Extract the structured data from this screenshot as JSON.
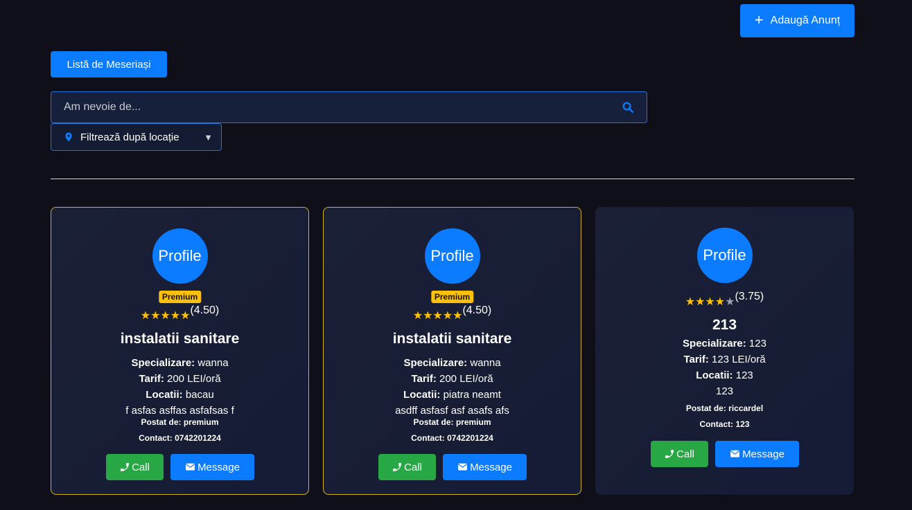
{
  "header": {
    "add_button_icon": "plus-icon",
    "add_button_label": "Adaugă Anunț",
    "list_button_label": "Listă de Meseriași"
  },
  "search": {
    "placeholder": "Am nevoie de...",
    "icon": "search-icon"
  },
  "location_filter": {
    "icon": "map-pin-icon",
    "label": "Filtrează după locație",
    "caret": "▼"
  },
  "colors": {
    "background": "#0e0f19",
    "accent": "#0b7bff",
    "premium_border": "#d4b21f",
    "star": "#ffc107",
    "call": "#28a745"
  },
  "cards": [
    {
      "premium": true,
      "avatar_text": "Profile",
      "badge": "Premium",
      "stars": 5,
      "rating": "(4.50)",
      "title": "instalatii sanitare",
      "specializare_label": "Specializare:",
      "specializare": "wanna",
      "tarif_label": "Tarif:",
      "tarif": "200 LEI/oră",
      "locatii_label": "Locatii:",
      "locatii": "bacau",
      "description": "f asfas asffas asfafsas f",
      "postat": "Postat de: premium",
      "contact": "Contact: 0742201224",
      "call_label": "Call",
      "message_label": "Message"
    },
    {
      "premium": true,
      "avatar_text": "Profile",
      "badge": "Premium",
      "stars": 5,
      "rating": "(4.50)",
      "title": "instalatii sanitare",
      "specializare_label": "Specializare:",
      "specializare": "wanna",
      "tarif_label": "Tarif:",
      "tarif": "200 LEI/oră",
      "locatii_label": "Locatii:",
      "locatii": "piatra neamt",
      "description": "asdff asfasf asf asafs afs",
      "postat": "Postat de: premium",
      "contact": "Contact: 0742201224",
      "call_label": "Call",
      "message_label": "Message"
    },
    {
      "premium": false,
      "avatar_text": "Profile",
      "stars": 4,
      "rating": "(3.75)",
      "title": "213",
      "specializare_label": "Specializare:",
      "specializare": "123",
      "tarif_label": "Tarif:",
      "tarif": "123 LEI/oră",
      "locatii_label": "Locatii:",
      "locatii": "123",
      "description": "123",
      "postat": "Postat de: riccardel",
      "contact": "Contact: 123",
      "call_label": "Call",
      "message_label": "Message"
    }
  ]
}
